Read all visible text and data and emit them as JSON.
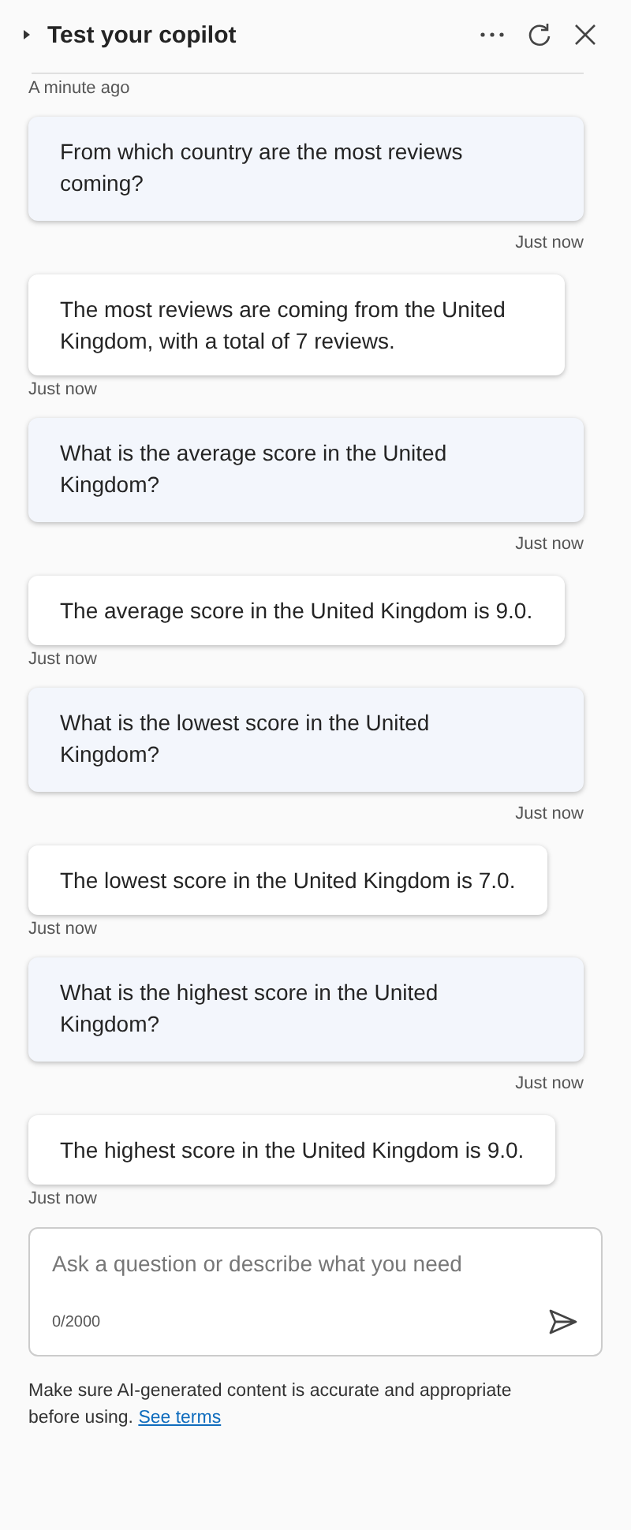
{
  "header": {
    "title": "Test your copilot"
  },
  "first_time": "A minute ago",
  "messages": [
    {
      "kind": "user",
      "text": "From which country are the most reviews coming?",
      "time": "Just now"
    },
    {
      "kind": "bot",
      "text": "The most reviews are coming from the United Kingdom, with a total of 7 reviews.",
      "time": "Just now"
    },
    {
      "kind": "user",
      "text": "What is the average score in the United Kingdom?",
      "time": "Just now"
    },
    {
      "kind": "bot",
      "text": "The average score in the United Kingdom is 9.0.",
      "time": "Just now"
    },
    {
      "kind": "user",
      "text": "What is the lowest score in the United Kingdom?",
      "time": "Just now"
    },
    {
      "kind": "bot",
      "text": "The lowest score in the United Kingdom is 7.0.",
      "time": "Just now"
    },
    {
      "kind": "user",
      "text": "What is the highest score in the United Kingdom?",
      "time": "Just now"
    },
    {
      "kind": "bot",
      "text": "The highest score in the United Kingdom is 9.0.",
      "time": "Just now"
    }
  ],
  "input": {
    "placeholder": "Ask a question or describe what you need",
    "counter": "0/2000"
  },
  "disclaimer": {
    "text": "Make sure AI-generated content is accurate and appropriate before using.",
    "link": "See terms"
  }
}
